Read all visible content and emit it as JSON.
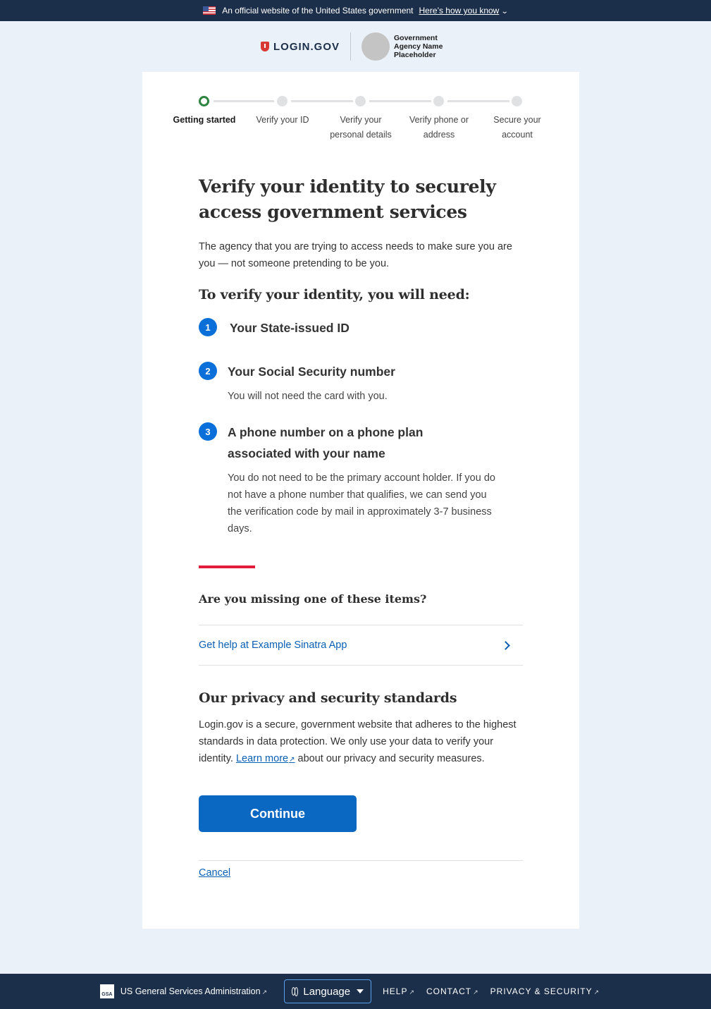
{
  "banner": {
    "text": "An official website of the United States government",
    "link": "Here’s how you know"
  },
  "header": {
    "logo_text": "LOGIN.GOV",
    "agency_name": "Government Agency Name Placeholder"
  },
  "steps": [
    {
      "label": "Getting started",
      "state": "current"
    },
    {
      "label": "Verify your ID",
      "state": "upcoming"
    },
    {
      "label": "Verify your personal details",
      "state": "upcoming"
    },
    {
      "label": "Verify phone or address",
      "state": "upcoming"
    },
    {
      "label": "Secure your account",
      "state": "upcoming"
    }
  ],
  "main": {
    "title": "Verify your identity to securely access government services",
    "lead": "The agency that you are trying to access needs to make sure you are you — not someone pretending to be you.",
    "requirements_heading": "To verify your identity, you will need:",
    "requirements": [
      {
        "number": "1",
        "title": "Your State-issued ID",
        "description": ""
      },
      {
        "number": "2",
        "title": "Your Social Security number",
        "description": "You will not need the card with you."
      },
      {
        "number": "3",
        "title": "A phone number on a phone plan associated with your name",
        "description": "You do not need to be the primary account holder. If you do not have a phone number that qualifies, we can send you the verification code by mail in approximately 3-7 business days."
      }
    ],
    "missing_heading": "Are you missing one of these items?",
    "help_link": "Get help at Example Sinatra App",
    "privacy_heading": "Our privacy and security standards",
    "privacy_text_before": "Login.gov is a secure, government website that adheres to the highest standards in data protection. We only use your data to verify your identity.",
    "privacy_link": "Learn more",
    "privacy_text_after": "about our privacy and security measures.",
    "continue_label": "Continue",
    "cancel_label": "Cancel"
  },
  "footer": {
    "gsa_logo": "GSA",
    "gsa_label": "US General Services Administration",
    "language_label": "Language",
    "help": "HELP",
    "contact": "CONTACT",
    "privacy": "PRIVACY & SECURITY"
  },
  "colors": {
    "navy": "#1c2f4a",
    "primary": "#0a67c2",
    "success": "#2e8540",
    "accent_red": "#e21c3d",
    "page_bg": "#eaf1f8"
  }
}
